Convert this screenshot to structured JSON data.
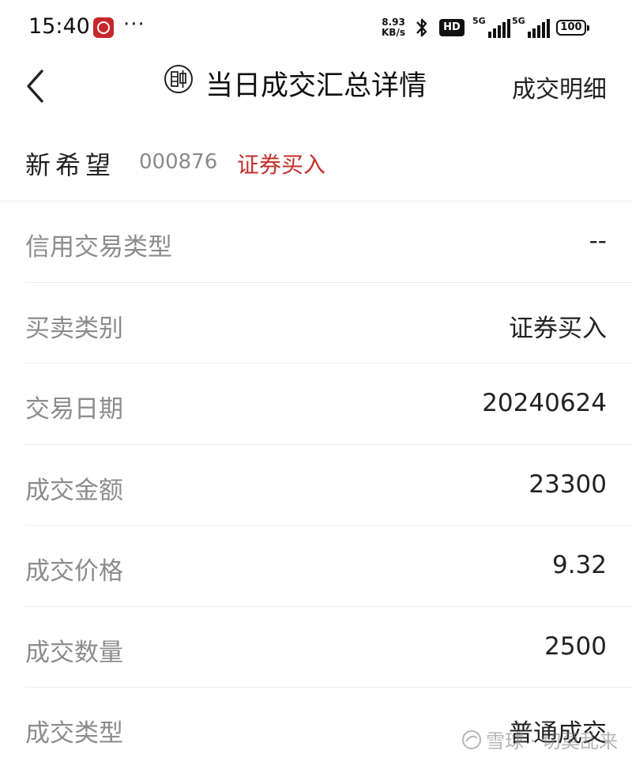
{
  "status_bar": {
    "time": "15:40",
    "net_speed_value": "8.93",
    "net_speed_unit": "KB/s",
    "hd_label": "HD",
    "sim1_label": "5G",
    "sim2_label": "5G",
    "battery": "100"
  },
  "nav": {
    "title": "当日成交汇总详情",
    "right_link": "成交明细"
  },
  "stock": {
    "name": "新希望",
    "code": "000876",
    "direction": "证券买入",
    "direction_color": "#c3302c"
  },
  "details": [
    {
      "label": "信用交易类型",
      "value": "--"
    },
    {
      "label": "买卖类别",
      "value": "证券买入"
    },
    {
      "label": "交易日期",
      "value": "20240624"
    },
    {
      "label": "成交金额",
      "value": "23300"
    },
    {
      "label": "成交价格",
      "value": "9.32"
    },
    {
      "label": "成交数量",
      "value": "2500"
    },
    {
      "label": "成交类型",
      "value": "普通成交"
    }
  ],
  "watermark": {
    "text": "雪球 · 切莫乱来"
  }
}
